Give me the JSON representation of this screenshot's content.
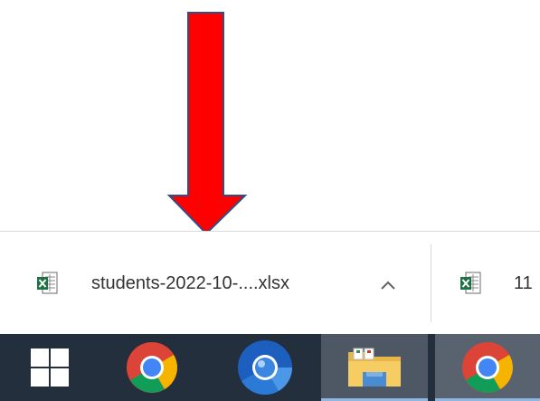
{
  "downloads": [
    {
      "filename": "students-2022-10-....xlsx",
      "icon": "excel-file-icon"
    },
    {
      "filename": "11",
      "icon": "excel-file-icon"
    }
  ],
  "shelf": {
    "expand_icon": "chevron-up-icon"
  },
  "taskbar": {
    "items": [
      {
        "name": "start-button",
        "icon": "windows-logo-icon"
      },
      {
        "name": "chrome",
        "icon": "chrome-icon"
      },
      {
        "name": "chromium",
        "icon": "chromium-icon"
      },
      {
        "name": "file-explorer",
        "icon": "folder-icon"
      },
      {
        "name": "chrome-active",
        "icon": "chrome-icon"
      }
    ]
  },
  "colors": {
    "arrow": "#ff0000",
    "arrow_outline": "#2f4f8a",
    "taskbar": "#242f3d",
    "excel_green": "#1e7145"
  }
}
